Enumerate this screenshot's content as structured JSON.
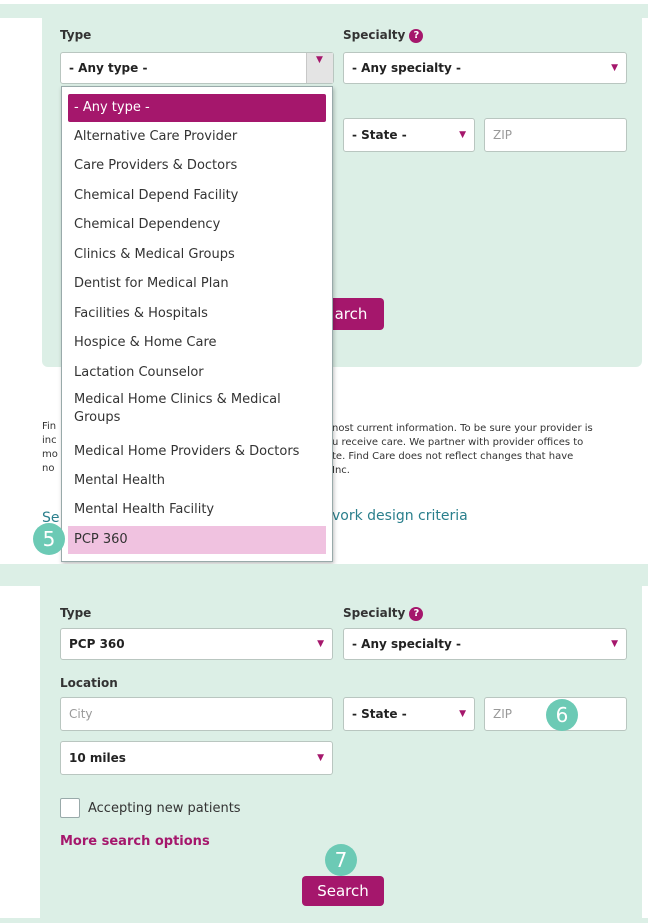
{
  "top": {
    "type_label": "Type",
    "specialty_label": "Specialty",
    "type_value": "- Any type -",
    "specialty_value": "- Any specialty -",
    "state_value": "- State -",
    "zip_placeholder": "ZIP",
    "search_partial": "arch",
    "dropdown_items": [
      "- Any type -",
      "Alternative Care Provider",
      "Care Providers & Doctors",
      "Chemical Depend Facility",
      "Chemical Dependency",
      "Clinics & Medical Groups",
      "Dentist for Medical Plan",
      "Facilities & Hospitals",
      "Hospice & Home Care",
      "Lactation Counselor",
      "Medical Home Clinics & Medical Groups",
      "Medical Home Providers & Doctors",
      "Mental Health",
      "Mental Health Facility",
      "PCP 360"
    ],
    "step_badge": "5",
    "info_text_lines": [
      "nost current information. To be sure your provider is",
      "u receive care. We partner with provider offices to",
      "te. Find Care does not reflect changes that have",
      "Inc."
    ],
    "left_fragments": [
      "Fin",
      "inc",
      "mo",
      "no"
    ],
    "network_link": "vork design criteria",
    "network_link_prefix": "Se"
  },
  "bottom": {
    "type_label": "Type",
    "specialty_label": "Specialty",
    "type_value": "PCP 360",
    "specialty_value": "- Any specialty -",
    "location_label": "Location",
    "city_placeholder": "City",
    "state_value": "- State -",
    "zip_placeholder": "ZIP",
    "distance_value": "10 miles",
    "accepting_label": "Accepting new patients",
    "accepting_checked": false,
    "more_options": "More search options",
    "search_label": "Search",
    "badge_6": "6",
    "badge_7": "7"
  },
  "colors": {
    "accent": "#a5176c",
    "panel": "#dcefe6",
    "badge": "#6ccab5",
    "highlight": "#f0c2e0"
  },
  "icons": {
    "help": "question-circle-icon",
    "caret": "caret-down-icon"
  }
}
